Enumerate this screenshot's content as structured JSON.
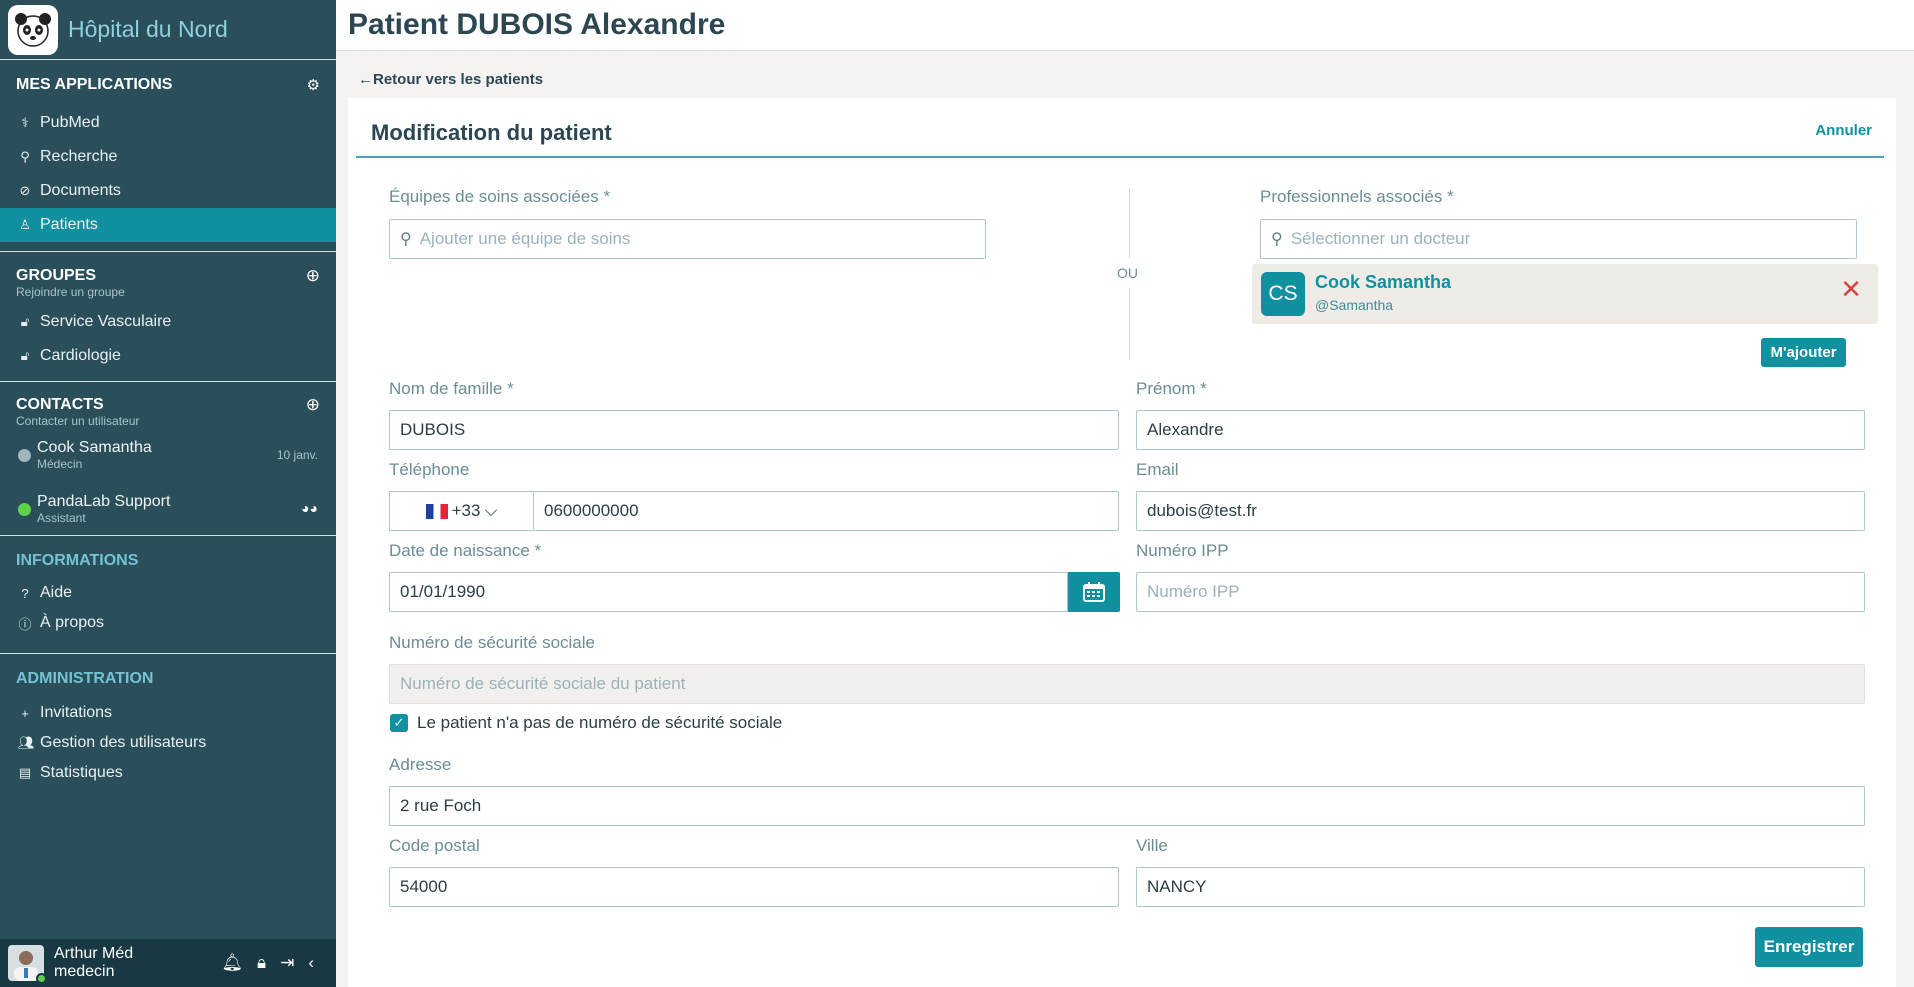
{
  "sidebar": {
    "hospital_name": "Hôpital du Nord",
    "apps_title": "MES APPLICATIONS",
    "apps": [
      {
        "label": "PubMed",
        "icon": "user-doctor-icon"
      },
      {
        "label": "Recherche",
        "icon": "search-icon"
      },
      {
        "label": "Documents",
        "icon": "paperclip-icon"
      },
      {
        "label": "Patients",
        "icon": "user-icon",
        "active": true
      }
    ],
    "groups_title": "GROUPES",
    "groups_sub": "Rejoindre un groupe",
    "groups": [
      {
        "label": "Service Vasculaire",
        "icon": "lock-icon"
      },
      {
        "label": "Cardiologie",
        "icon": "lock-icon"
      }
    ],
    "contacts_title": "CONTACTS",
    "contacts_sub": "Contacter un utilisateur",
    "contacts": [
      {
        "name": "Cook Samantha",
        "role": "Médecin",
        "date": "10 janv.",
        "status_color": "#9fb6bd"
      },
      {
        "name": "PandaLab Support",
        "role": "Assistant",
        "status_color": "#5ed04a"
      }
    ],
    "info_title": "INFORMATIONS",
    "info": [
      {
        "label": "Aide",
        "icon": "question-icon"
      },
      {
        "label": "À propos",
        "icon": "info-icon"
      }
    ],
    "admin_title": "ADMINISTRATION",
    "admin": [
      {
        "label": "Invitations",
        "icon": "plus-icon"
      },
      {
        "label": "Gestion des utilisateurs",
        "icon": "users-icon"
      },
      {
        "label": "Statistiques",
        "icon": "chart-file-icon"
      }
    ],
    "user": {
      "name": "Arthur Méd",
      "role": "medecin"
    }
  },
  "main": {
    "title": "Patient DUBOIS Alexandre",
    "back_label": "Retour vers les patients",
    "form_title": "Modification du patient",
    "cancel_label": "Annuler",
    "care_teams_label": "Équipes de soins associées *",
    "care_teams_placeholder": "Ajouter une équipe de soins",
    "or_label": "OU",
    "professionals_label": "Professionnels associés *",
    "professionals_placeholder": "Sélectionner un docteur",
    "professional": {
      "initials": "CS",
      "name": "Cook Samantha",
      "username": "@Samantha"
    },
    "add_me_label": "M'ajouter",
    "lastname_label": "Nom de famille *",
    "lastname_value": "DUBOIS",
    "firstname_label": "Prénom *",
    "firstname_value": "Alexandre",
    "phone_label": "Téléphone",
    "phone_prefix": "+33",
    "phone_value": "0600000000",
    "email_label": "Email",
    "email_value": "dubois@test.fr",
    "birthdate_label": "Date de naissance *",
    "birthdate_value": "01/01/1990",
    "ipp_label": "Numéro IPP",
    "ipp_placeholder": "Numéro IPP",
    "ssn_label": "Numéro de sécurité sociale",
    "ssn_placeholder": "Numéro de sécurité sociale du patient",
    "no_ssn_label": "Le patient n'a pas de numéro de sécurité sociale",
    "no_ssn_checked": true,
    "address_label": "Adresse",
    "address_value": "2 rue Foch",
    "postal_label": "Code postal",
    "postal_value": "54000",
    "city_label": "Ville",
    "city_value": "NANCY",
    "save_label": "Enregistrer"
  }
}
